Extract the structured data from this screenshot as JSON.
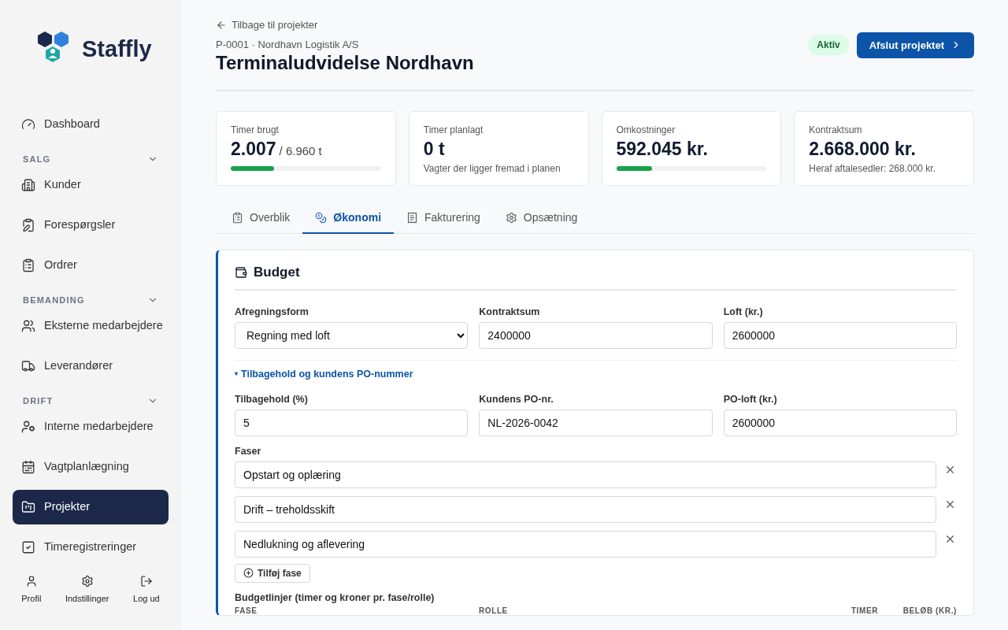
{
  "sidebar": {
    "logo": "Staffly",
    "groups": [
      {
        "items": [
          {
            "label": "Dashboard",
            "selected": false
          }
        ]
      },
      {
        "heading": "SALG",
        "expanded": true,
        "items": [
          {
            "label": "Kunder",
            "selected": false
          },
          {
            "label": "Forespørgsler",
            "selected": false
          },
          {
            "label": "Ordrer",
            "selected": false
          }
        ]
      },
      {
        "heading": "BEMANDING",
        "expanded": true,
        "items": [
          {
            "label": "Eksterne medarbejdere",
            "selected": false
          },
          {
            "label": "Leverandører",
            "selected": false
          }
        ]
      },
      {
        "heading": "DRIFT",
        "expanded": true,
        "items": [
          {
            "label": "Interne medarbejdere",
            "selected": false
          },
          {
            "label": "Vagtplanlægning",
            "selected": false
          },
          {
            "label": "Projekter",
            "selected": true
          },
          {
            "label": "Timeregistreringer",
            "selected": false
          }
        ]
      }
    ],
    "footer": [
      "Profil",
      "Indstillinger",
      "Log ud"
    ]
  },
  "header": {
    "back_link": "Tilbage til projekter",
    "subtitle": "P-0001 · Nordhavn Logistik A/S",
    "title": "Terminaludvidelse Nordhavn",
    "status": "Aktiv",
    "action": "Afslut projektet"
  },
  "stats": [
    {
      "label": "Timer brugt",
      "value": "2.007",
      "unit": "/ 6.960 t",
      "level": 0.29
    },
    {
      "label": "Timer planlagt",
      "value": "0 t",
      "note": "Vagter der ligger fremad i planen"
    },
    {
      "label": "Omkostninger",
      "value": "592.045 kr.",
      "level": 0.24
    },
    {
      "label": "Kontraktsum",
      "value": "2.668.000 kr.",
      "note": "Heraf aftalesedler: 268.000 kr."
    }
  ],
  "tabs": [
    {
      "label": "Overblik",
      "selected": false
    },
    {
      "label": "Økonomi",
      "selected": true
    },
    {
      "label": "Fakturering",
      "selected": false
    },
    {
      "label": "Opsætning",
      "selected": false
    }
  ],
  "budget": {
    "title": "Budget",
    "fields": [
      {
        "label": "Afregningsform",
        "kind": "select",
        "value": "Regning med loft"
      },
      {
        "label": "Kontraktsum",
        "kind": "text",
        "value": "2400000"
      },
      {
        "label": "Loft (kr.)",
        "kind": "text",
        "value": "2600000"
      }
    ],
    "disclosure": {
      "marker": "▾",
      "label": "Tilbagehold og kundens PO-nummer",
      "expanded": true
    },
    "po_fields": [
      {
        "label": "Tilbagehold (%)",
        "kind": "text",
        "value": "5"
      },
      {
        "label": "Kundens PO-nr.",
        "kind": "text",
        "value": "NL-2026-0042"
      },
      {
        "label": "PO-loft (kr.)",
        "kind": "text",
        "value": "2600000"
      }
    ],
    "phases_label": "Faser",
    "phases": [
      "Opstart og oplæring",
      "Drift – treholdsskift",
      "Nedlukning og aflevering"
    ],
    "add_phase": "Tilføj fase",
    "lines_label": "Budgetlinjer (timer og kroner pr. fase/rolle)",
    "columns": [
      "FASE",
      "ROLLE",
      "TIMER",
      "BELØB (KR.)"
    ]
  }
}
